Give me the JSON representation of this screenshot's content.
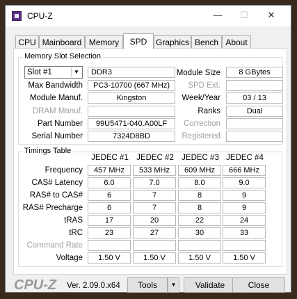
{
  "window": {
    "title": "CPU-Z",
    "minimize": "—",
    "maximize": "☐",
    "close": "✕"
  },
  "tabs": [
    "CPU",
    "Mainboard",
    "Memory",
    "SPD",
    "Graphics",
    "Bench",
    "About"
  ],
  "active_tab": "SPD",
  "slot_selection": {
    "title": "Memory Slot Selection",
    "slot": "Slot #1",
    "type": "DDR3",
    "labels": {
      "module_size": "Module Size",
      "max_bandwidth": "Max Bandwidth",
      "spd_ext": "SPD Ext.",
      "module_manuf": "Module Manuf.",
      "week_year": "Week/Year",
      "dram_manuf": "DRAM Manuf.",
      "ranks": "Ranks",
      "part_number": "Part Number",
      "correction": "Correction",
      "serial_number": "Serial Number",
      "registered": "Registered"
    },
    "values": {
      "module_size": "8 GBytes",
      "max_bandwidth": "PC3-10700 (667 MHz)",
      "spd_ext": "",
      "module_manuf": "Kingston",
      "week_year": "03 / 13",
      "dram_manuf": "",
      "ranks": "Dual",
      "part_number": "99U5471-040.A00LF",
      "correction": "",
      "serial_number": "7324D8BD",
      "registered": ""
    }
  },
  "timings": {
    "title": "Timings Table",
    "columns": [
      "JEDEC #1",
      "JEDEC #2",
      "JEDEC #3",
      "JEDEC #4"
    ],
    "rows": [
      {
        "label": "Frequency",
        "values": [
          "457 MHz",
          "533 MHz",
          "609 MHz",
          "666 MHz"
        ]
      },
      {
        "label": "CAS# Latency",
        "values": [
          "6.0",
          "7.0",
          "8.0",
          "9.0"
        ]
      },
      {
        "label": "RAS# to CAS#",
        "values": [
          "6",
          "7",
          "8",
          "9"
        ]
      },
      {
        "label": "RAS# Precharge",
        "values": [
          "6",
          "7",
          "8",
          "9"
        ]
      },
      {
        "label": "tRAS",
        "values": [
          "17",
          "20",
          "22",
          "24"
        ]
      },
      {
        "label": "tRC",
        "values": [
          "23",
          "27",
          "30",
          "33"
        ]
      },
      {
        "label": "Command Rate",
        "values": [
          "",
          "",
          "",
          ""
        ]
      },
      {
        "label": "Voltage",
        "values": [
          "1.50 V",
          "1.50 V",
          "1.50 V",
          "1.50 V"
        ]
      }
    ]
  },
  "footer": {
    "brand": "CPU-Z",
    "version": "Ver. 2.09.0.x64",
    "tools": "Tools",
    "validate": "Validate",
    "close": "Close"
  }
}
